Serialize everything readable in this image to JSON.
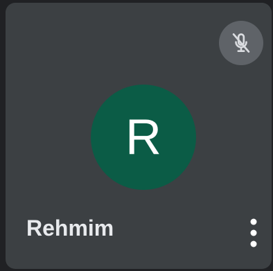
{
  "participant": {
    "name": "Rehmim",
    "initial": "R",
    "muted": true,
    "avatar_color": "#0b5c46",
    "tile_background": "#3c4043",
    "mic_badge_background": "#5f6368"
  },
  "icons": {
    "mic": "mic-off-icon",
    "menu": "more-vert-icon"
  }
}
